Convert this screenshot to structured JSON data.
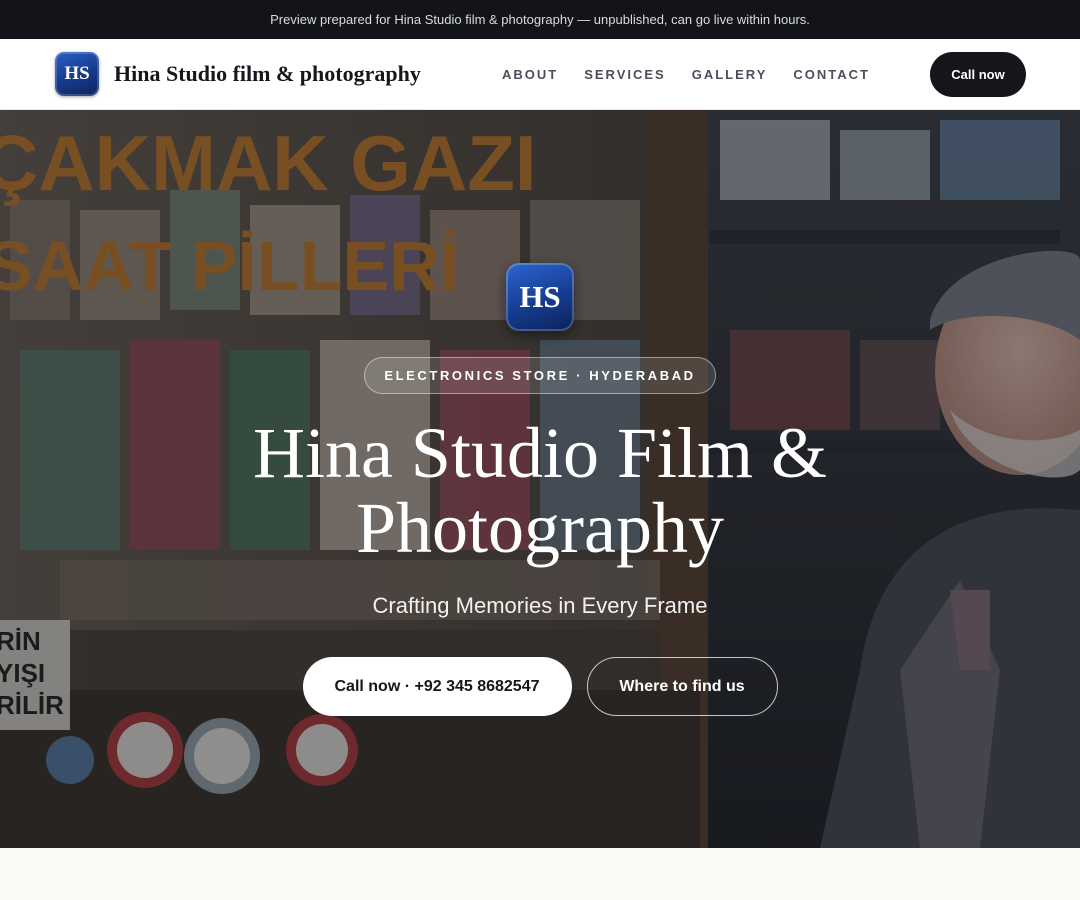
{
  "topbar": {
    "text": "Preview prepared for Hina Studio film & photography — unpublished, can go live within hours."
  },
  "nav": {
    "logo_text": "HS",
    "brand": "Hina Studio film & photography",
    "links": [
      "ABOUT",
      "SERVICES",
      "GALLERY",
      "CONTACT"
    ],
    "cta": "Call now"
  },
  "hero": {
    "badge_text": "HS",
    "pill": "ELECTRONICS STORE · HYDERABAD",
    "title_line1": "Hina Studio Film &",
    "title_line2": "Photography",
    "tagline": "Crafting Memories in Every Frame",
    "primary_cta": "Call now · +92 345 8682547",
    "secondary_cta": "Where to find us",
    "sign_line1": "ÇAKMAK GAZI",
    "sign_line2": "SAAT PİLLERİ",
    "side_sign": [
      "RİN",
      "YIŞI",
      "RİLİR"
    ]
  },
  "colors": {
    "accent": "#14161b",
    "badge_blue": "#163a8a",
    "topbar": "#121419"
  }
}
